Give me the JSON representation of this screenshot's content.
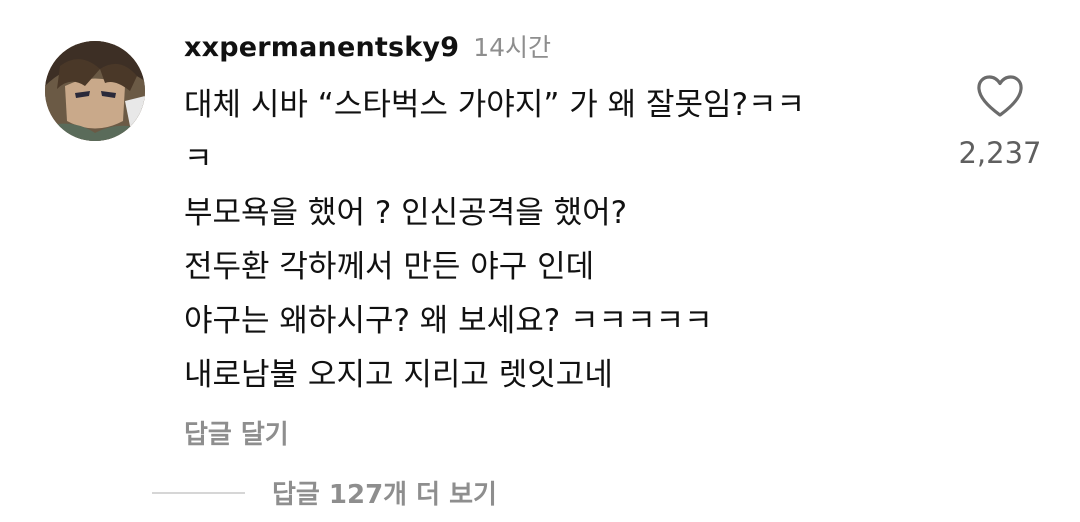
{
  "comment": {
    "username": "xxpermanentsky9",
    "time": "14시간",
    "lines": [
      "대체 시바 “스타벅스 가야지” 가 왜 잘못임?ㅋㅋ",
      "ㅋ",
      "부모욕을 했어 ? 인신공격을 했어?",
      "전두환 각하께서 만든 야구 인데",
      "야구는 왜하시구? 왜 보세요? ㅋㅋㅋㅋㅋ",
      "내로남불 오지고 지리고 렛잇고네"
    ],
    "reply_label": "답글 달기",
    "like_icon": "heart-outline-icon",
    "like_count": "2,237"
  },
  "more_replies_label": "답글 127개 더 보기"
}
